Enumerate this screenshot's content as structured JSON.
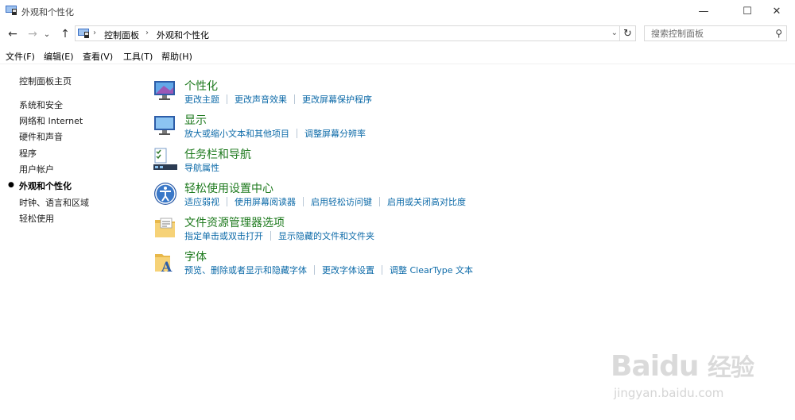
{
  "window": {
    "title": "外观和个性化",
    "minimize_glyph": "—",
    "maximize_glyph": "☐",
    "close_glyph": "✕"
  },
  "nav": {
    "back_glyph": "←",
    "forward_glyph": "→",
    "recent_glyph": "⌄",
    "up_glyph": "↑",
    "breadcrumb": [
      "控制面板",
      "外观和个性化"
    ],
    "breadcrumb_sep": "›",
    "dropdown_glyph": "⌄",
    "refresh_glyph": "↻",
    "search_placeholder": "搜索控制面板",
    "search_glyph": "⚲"
  },
  "menu": [
    "文件(F)",
    "编辑(E)",
    "查看(V)",
    "工具(T)",
    "帮助(H)"
  ],
  "sidebar": {
    "home": "控制面板主页",
    "items": [
      {
        "label": "系统和安全",
        "current": false
      },
      {
        "label": "网络和 Internet",
        "current": false
      },
      {
        "label": "硬件和声音",
        "current": false
      },
      {
        "label": "程序",
        "current": false
      },
      {
        "label": "用户帐户",
        "current": false
      },
      {
        "label": "外观和个性化",
        "current": true
      },
      {
        "label": "时钟、语言和区域",
        "current": false
      },
      {
        "label": "轻松使用",
        "current": false
      }
    ],
    "bullet_glyph": "●"
  },
  "categories": [
    {
      "icon": "personalization-icon",
      "title": "个性化",
      "links": [
        "更改主题",
        "更改声音效果",
        "更改屏幕保护程序"
      ]
    },
    {
      "icon": "display-icon",
      "title": "显示",
      "links": [
        "放大或缩小文本和其他项目",
        "调整屏幕分辨率"
      ]
    },
    {
      "icon": "taskbar-icon",
      "title": "任务栏和导航",
      "links": [
        "导航属性"
      ]
    },
    {
      "icon": "ease-of-access-icon",
      "title": "轻松使用设置中心",
      "links": [
        "适应弱视",
        "使用屏幕阅读器",
        "启用轻松访问键",
        "启用或关闭高对比度"
      ]
    },
    {
      "icon": "folder-options-icon",
      "title": "文件资源管理器选项",
      "links": [
        "指定单击或双击打开",
        "显示隐藏的文件和文件夹"
      ]
    },
    {
      "icon": "fonts-icon",
      "title": "字体",
      "links": [
        "预览、删除或者显示和隐藏字体",
        "更改字体设置",
        "调整 ClearType 文本"
      ]
    }
  ],
  "watermark": {
    "brand": "Bai",
    "brand2": "du",
    "brand_cn": "经验",
    "url": "jingyan.baidu.com"
  },
  "colors": {
    "category_title": "#1e7a1e",
    "link": "#0c6aa8"
  }
}
